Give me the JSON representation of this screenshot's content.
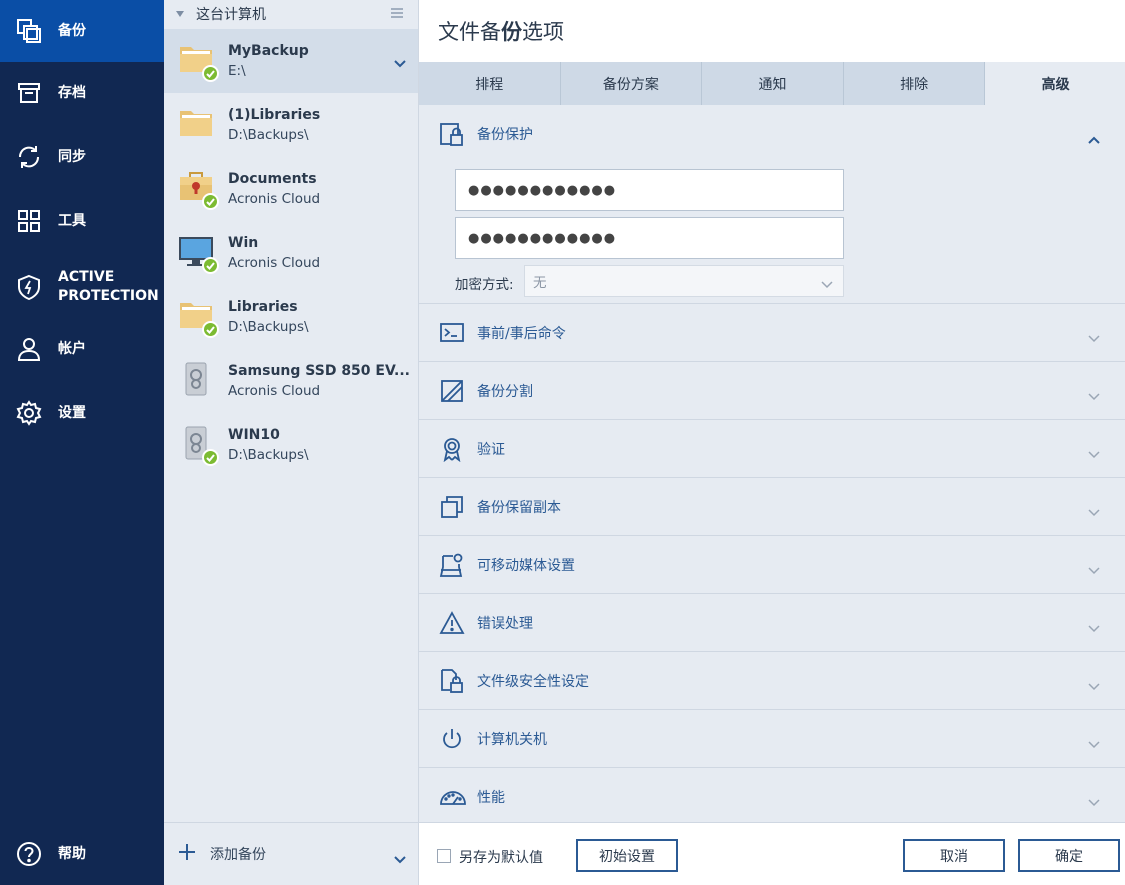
{
  "nav": {
    "items": [
      {
        "label": "备份",
        "icon": "backup-icon",
        "active": true
      },
      {
        "label": "存档",
        "icon": "archive-icon"
      },
      {
        "label": "同步",
        "icon": "sync-icon"
      },
      {
        "label": "工具",
        "icon": "tools-icon"
      },
      {
        "label": "ACTIVE\nPROTECTION",
        "icon": "shield-icon"
      },
      {
        "label": "帐户",
        "icon": "user-icon"
      },
      {
        "label": "设置",
        "icon": "gear-icon"
      }
    ],
    "help": {
      "label": "帮助",
      "icon": "help-icon"
    }
  },
  "backup_list": {
    "header": "这台计算机",
    "items": [
      {
        "name": "MyBackup",
        "location": "E:\\",
        "icon": "folder-icon",
        "status": "ok",
        "selected": true
      },
      {
        "name": "(1)Libraries",
        "location": "D:\\Backups\\",
        "icon": "folder-icon"
      },
      {
        "name": "Documents",
        "location": "Acronis Cloud",
        "icon": "briefcase-icon",
        "status": "ok"
      },
      {
        "name": "Win",
        "location": "Acronis Cloud",
        "icon": "monitor-icon",
        "status": "ok"
      },
      {
        "name": "Libraries",
        "location": "D:\\Backups\\",
        "icon": "folder-icon",
        "status": "ok"
      },
      {
        "name": "Samsung SSD 850 EV...",
        "location": "Acronis Cloud",
        "icon": "disk-icon"
      },
      {
        "name": "WIN10",
        "location": "D:\\Backups\\",
        "icon": "disk-icon",
        "status": "ok"
      }
    ],
    "add_label": "添加备份"
  },
  "main": {
    "title_parts": {
      "pre": "文件备",
      "bold": "份",
      "post": "选项"
    },
    "tabs": [
      {
        "label": "排程"
      },
      {
        "label": "备份方案"
      },
      {
        "label": "通知"
      },
      {
        "label": "排除"
      },
      {
        "label": "高级",
        "active": true
      }
    ],
    "protection": {
      "label": "备份保护",
      "password_mask": "●●●●●●●●●●●●",
      "confirm_mask": "●●●●●●●●●●●●",
      "encryption_label": "加密方式:",
      "encryption_value": "无"
    },
    "sections": [
      {
        "label": "事前/事后命令",
        "icon": "terminal-icon"
      },
      {
        "label": "备份分割",
        "icon": "split-icon"
      },
      {
        "label": "验证",
        "icon": "badge-icon"
      },
      {
        "label": "备份保留副本",
        "icon": "copy-icon"
      },
      {
        "label": "可移动媒体设置",
        "icon": "removable-media-icon"
      },
      {
        "label": "错误处理",
        "icon": "warning-icon"
      },
      {
        "label": "文件级安全性设定",
        "icon": "file-lock-icon"
      },
      {
        "label": "计算机关机",
        "icon": "power-icon"
      },
      {
        "label": "性能",
        "icon": "gauge-icon"
      }
    ]
  },
  "footer": {
    "save_default_label": "另存为默认值",
    "reset_label": "初始设置",
    "cancel_label": "取消",
    "ok_label": "确定"
  },
  "colors": {
    "nav_bg": "#112852",
    "nav_active": "#0a4ea6",
    "panel_bg": "#e6ebf2",
    "accent": "#2b5a94",
    "status_ok": "#7cbb32"
  }
}
